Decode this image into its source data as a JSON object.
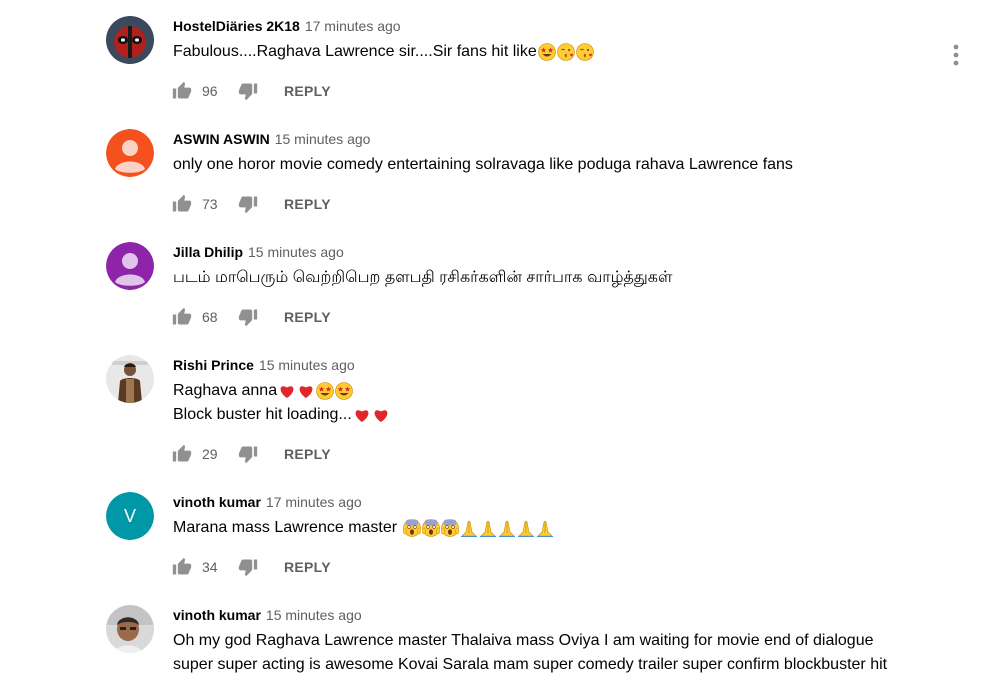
{
  "comments": [
    {
      "author": "HostelDiäries 2K18",
      "time": "17 minutes ago",
      "lines": [
        "Fabulous....Raghava Lawrence sir....Sir fans hit like"
      ],
      "emojis": [
        [
          "star-struck",
          "kissing-heart",
          "kissing-heart"
        ]
      ],
      "likes": "96",
      "reply": "REPLY",
      "avatar": "photo",
      "show_menu": true
    },
    {
      "author": "ASWIN ASWIN",
      "time": "15 minutes ago",
      "lines": [
        "only one horor movie  comedy entertaining solravaga like poduga rahava Lawrence fans"
      ],
      "likes": "73",
      "reply": "REPLY",
      "avatar": "default",
      "avatar_color": "#f4511e"
    },
    {
      "author": "Jilla Dhilip",
      "time": "15 minutes ago",
      "lines": [
        "படம் மாபெரும் வெற்றிபெற தளபதி ரசிகர்களின் சார்பாக வாழ்த்துகள்"
      ],
      "likes": "68",
      "reply": "REPLY",
      "avatar": "default",
      "avatar_color": "#8e24aa"
    },
    {
      "author": "Rishi Prince",
      "time": "15 minutes ago",
      "lines": [
        "Raghava anna",
        "Block buster hit loading..."
      ],
      "emojis": [
        [
          "red-heart",
          "red-heart",
          "star-struck",
          "star-struck"
        ],
        [
          "red-heart",
          "red-heart"
        ]
      ],
      "likes": "29",
      "reply": "REPLY",
      "avatar": "photo"
    },
    {
      "author": "vinoth kumar",
      "time": "17 minutes ago",
      "lines": [
        "Marana mass Lawrence master "
      ],
      "emojis": [
        [
          "screaming-face",
          "screaming-face",
          "screaming-face",
          "folded-hands",
          "folded-hands",
          "folded-hands",
          "folded-hands",
          "folded-hands"
        ]
      ],
      "likes": "34",
      "reply": "REPLY",
      "avatar": "letter",
      "avatar_letter": "V",
      "avatar_color": "#0097a7"
    },
    {
      "author": "vinoth kumar",
      "time": "15 minutes ago",
      "lines": [
        "Oh my god Raghava Lawrence master Thalaiva mass Oviya I am waiting for movie end of dialogue",
        "super super acting is awesome Kovai Sarala mam super comedy  trailer super confirm blockbuster hit"
      ],
      "avatar": "photo"
    }
  ],
  "colors": {
    "secondary_text": "#606060",
    "primary_text": "#030303"
  }
}
